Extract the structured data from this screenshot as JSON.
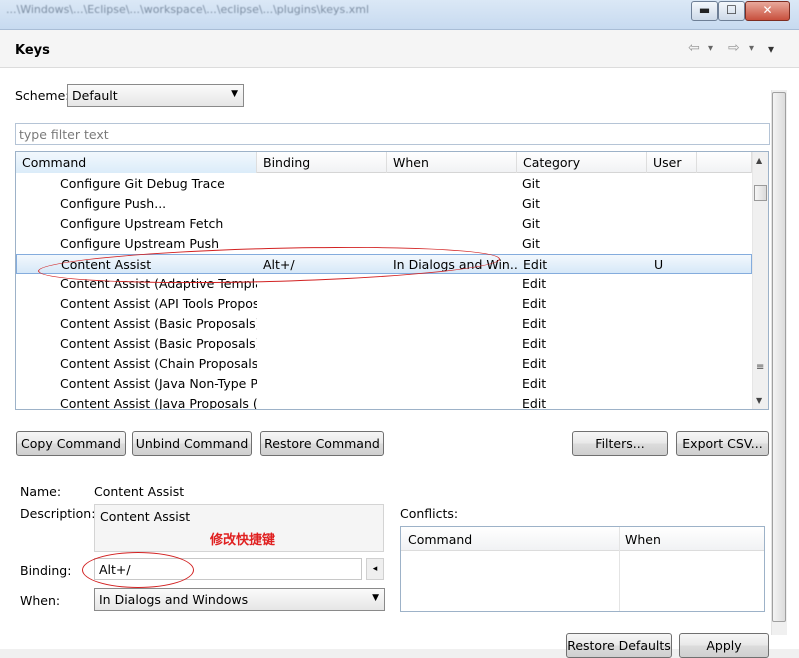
{
  "window": {
    "title_path": "...\\Windows\\...\\Eclipse\\...\\workspace\\...\\eclipse\\...\\plugins\\keys.xml",
    "min_glyph": "▬",
    "max_glyph": "☐",
    "close_glyph": "✕"
  },
  "page": {
    "title": "Keys",
    "nav_back": "⇦",
    "nav_forward": "⇨",
    "menu": "▾"
  },
  "scheme": {
    "label": "Scheme:",
    "value": "Default"
  },
  "filter": {
    "placeholder": "type filter text",
    "value": ""
  },
  "table": {
    "columns": [
      "Command",
      "Binding",
      "When",
      "Category",
      "User"
    ],
    "rows": [
      {
        "command": "Configure Git Debug Trace",
        "binding": "",
        "when": "",
        "category": "Git",
        "user": "",
        "selected": false
      },
      {
        "command": "Configure Push...",
        "binding": "",
        "when": "",
        "category": "Git",
        "user": "",
        "selected": false
      },
      {
        "command": "Configure Upstream Fetch",
        "binding": "",
        "when": "",
        "category": "Git",
        "user": "",
        "selected": false
      },
      {
        "command": "Configure Upstream Push",
        "binding": "",
        "when": "",
        "category": "Git",
        "user": "",
        "selected": false
      },
      {
        "command": "Content Assist",
        "binding": "Alt+/",
        "when": "In Dialogs and Win...",
        "category": "Edit",
        "user": "U",
        "selected": true
      },
      {
        "command": "Content Assist (Adaptive Template",
        "binding": "",
        "when": "",
        "category": "Edit",
        "user": "",
        "selected": false
      },
      {
        "command": "Content Assist (API Tools Proposa",
        "binding": "",
        "when": "",
        "category": "Edit",
        "user": "",
        "selected": false
      },
      {
        "command": "Content Assist (Basic Proposals)",
        "binding": "",
        "when": "",
        "category": "Edit",
        "user": "",
        "selected": false
      },
      {
        "command": "Content Assist (Basic Proposals)",
        "binding": "",
        "when": "",
        "category": "Edit",
        "user": "",
        "selected": false
      },
      {
        "command": "Content Assist (Chain Proposals (C",
        "binding": "",
        "when": "",
        "category": "Edit",
        "user": "",
        "selected": false
      },
      {
        "command": "Content Assist (Java Non-Type Pro",
        "binding": "",
        "when": "",
        "category": "Edit",
        "user": "",
        "selected": false
      },
      {
        "command": "Content Assist (Java Proposals (Co",
        "binding": "",
        "when": "",
        "category": "Edit",
        "user": "",
        "selected": false
      }
    ]
  },
  "buttons": {
    "copy": "Copy Command",
    "unbind": "Unbind Command",
    "restore": "Restore Command",
    "filters": "Filters...",
    "export": "Export CSV...",
    "restore_defaults": "Restore Defaults",
    "apply": "Apply"
  },
  "details": {
    "name_label": "Name:",
    "name_value": "Content Assist",
    "description_label": "Description:",
    "description_value": "Content Assist",
    "annotation": "修改快捷键",
    "binding_label": "Binding:",
    "binding_value": "Alt+/",
    "when_label": "When:",
    "when_value": "In Dialogs and Windows"
  },
  "conflicts": {
    "label": "Conflicts:",
    "columns": [
      "Command",
      "When"
    ]
  },
  "colors": {
    "accent_annotation": "#d22222",
    "selection_border": "#84acdd"
  }
}
